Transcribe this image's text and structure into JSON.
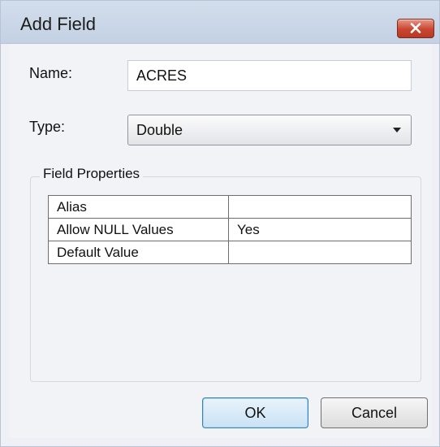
{
  "window": {
    "title": "Add Field"
  },
  "name_field": {
    "label": "Name:",
    "value": "ACRES"
  },
  "type_field": {
    "label": "Type:",
    "value": "Double"
  },
  "field_properties": {
    "title": "Field Properties",
    "rows": [
      {
        "property": "Alias",
        "value": ""
      },
      {
        "property": "Allow NULL Values",
        "value": "Yes"
      },
      {
        "property": "Default Value",
        "value": ""
      }
    ]
  },
  "buttons": {
    "ok": "OK",
    "cancel": "Cancel"
  },
  "colors": {
    "close_button": "#c9462f",
    "ok_border": "#3c7fb1"
  },
  "icons": {
    "close": "close-icon",
    "dropdown": "chevron-down-icon"
  }
}
